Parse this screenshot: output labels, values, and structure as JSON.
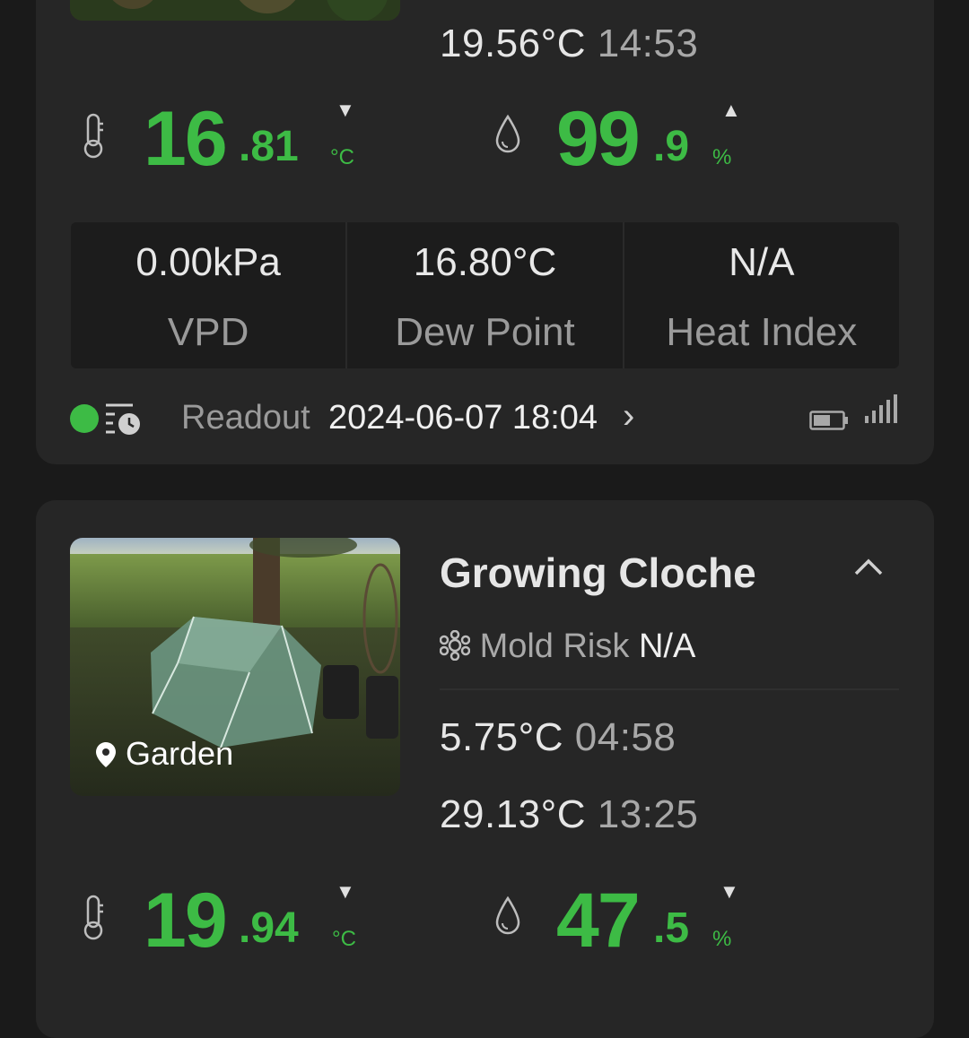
{
  "devices": [
    {
      "max": {
        "temp": "19.56°C",
        "time": "14:53"
      },
      "temperature": {
        "whole": "16",
        "decimal": ".81",
        "unit": "°C",
        "trend": "▼"
      },
      "humidity": {
        "whole": "99",
        "decimal": ".9",
        "unit": "%",
        "trend": "▲"
      },
      "metrics": [
        {
          "value": "0.00kPa",
          "label": "VPD"
        },
        {
          "value": "16.80°C",
          "label": "Dew Point"
        },
        {
          "value": "N/A",
          "label": "Heat Index"
        }
      ],
      "readout": {
        "label": "Readout",
        "value": "2024-06-07 18:04",
        "chevron": "›"
      },
      "status_color": "#3dbb45"
    },
    {
      "name": "Growing Cloche",
      "collapse_icon": "chevron-up-icon",
      "location": "Garden",
      "mold": {
        "label": "Mold Risk",
        "value": "N/A"
      },
      "min": {
        "temp": "5.75°C",
        "time": "04:58"
      },
      "max": {
        "temp": "29.13°C",
        "time": "13:25"
      },
      "temperature": {
        "whole": "19",
        "decimal": ".94",
        "unit": "°C",
        "trend": "▼"
      },
      "humidity": {
        "whole": "47",
        "decimal": ".5",
        "unit": "%",
        "trend": "▼"
      }
    }
  ],
  "colors": {
    "accent_green": "#3dbb45",
    "card_bg": "#262626",
    "page_bg": "#1a1a1a"
  }
}
